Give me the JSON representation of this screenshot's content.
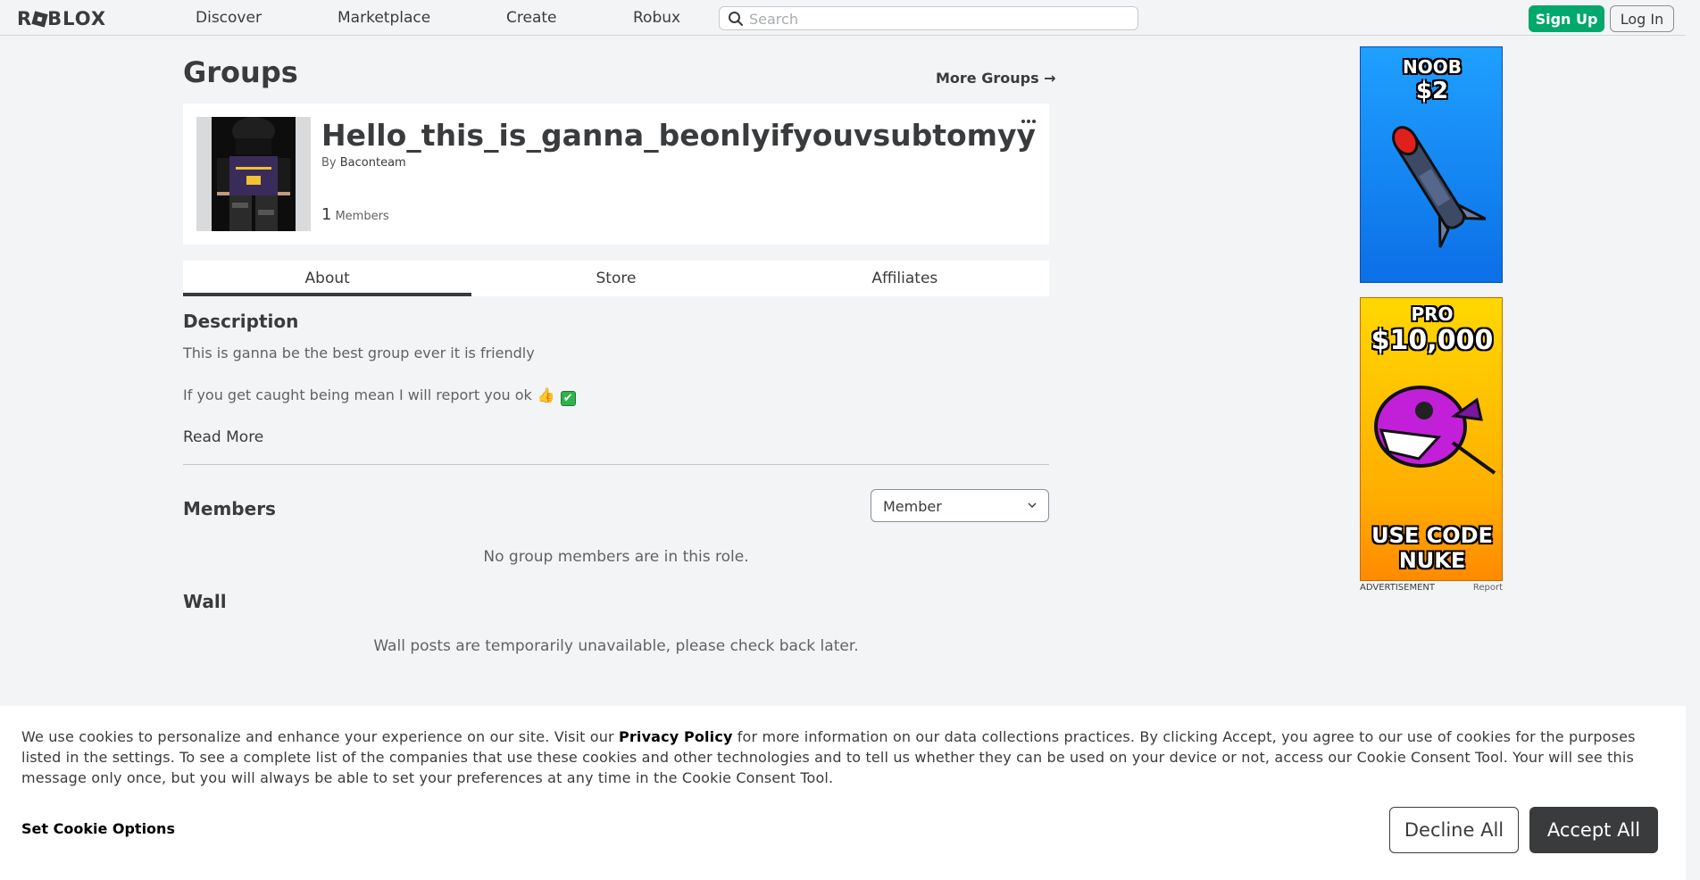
{
  "nav": {
    "logo": "ROBLOX",
    "links": [
      "Discover",
      "Marketplace",
      "Create",
      "Robux"
    ],
    "search_placeholder": "Search",
    "signup": "Sign Up",
    "login": "Log In"
  },
  "page": {
    "title": "Groups",
    "more_groups": "More Groups →"
  },
  "group": {
    "name": "Hello_this_is_ganna_beonlyifyouvsubtomyy...",
    "by_label": "By",
    "owner": "Baconteam",
    "member_count": "1",
    "members_label": "Members",
    "more_icon": "more-options-icon"
  },
  "tabs": [
    "About",
    "Store",
    "Affiliates"
  ],
  "about": {
    "description_heading": "Description",
    "description_line1": "This is ganna be the best group ever it is friendly",
    "description_line2": "If you get caught being mean I will report you ok",
    "emoji_thumb": "👍",
    "emoji_check": "✔",
    "read_more": "Read More",
    "members_heading": "Members",
    "role_selected": "Member",
    "members_empty": "No group members are in this role.",
    "wall_heading": "Wall",
    "wall_message": "Wall posts are temporarily unavailable, please check back later."
  },
  "ads": {
    "ad1_line1": "NOOB",
    "ad1_line2": "$2",
    "ad2_line1": "PRO",
    "ad2_line2": "$10,000",
    "ad2_line3": "USE CODE",
    "ad2_line4": "NUKE",
    "label": "ADVERTISEMENT",
    "report": "Report"
  },
  "cookie": {
    "text_before": "We use cookies to personalize and enhance your experience on our site. Visit our ",
    "privacy_link": "Privacy Policy",
    "text_after": " for more information on our data collections practices. By clicking Accept, you agree to our use of cookies for the purposes listed in the settings. To see a complete list of the companies that use these cookies and other technologies and to tell us whether they can be used on your device or not, access our Cookie Consent Tool. Your will see this message only once, but you will always be able to set your preferences at any time in the Cookie Consent Tool.",
    "set_options": "Set Cookie Options",
    "decline": "Decline All",
    "accept": "Accept All"
  },
  "colors": {
    "background": "#f2f4f5",
    "text": "#393b3d",
    "signup_green": "#00a86b",
    "accept_dark": "#393b3d"
  }
}
